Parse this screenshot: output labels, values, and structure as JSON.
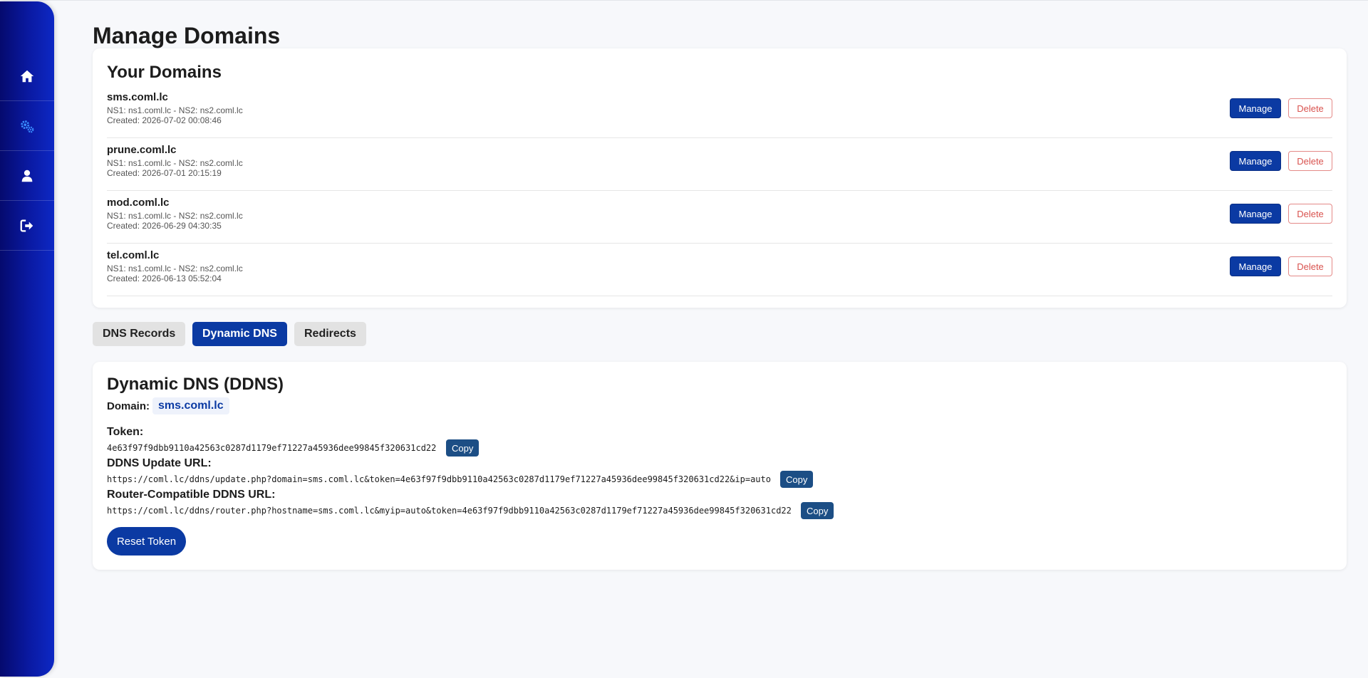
{
  "page": {
    "title": "Manage Domains"
  },
  "sidebar": {
    "items": [
      {
        "icon": "home-icon"
      },
      {
        "icon": "cogs-icon",
        "active": true
      },
      {
        "icon": "user-icon"
      },
      {
        "icon": "sign-out-icon"
      }
    ]
  },
  "domains_card": {
    "title": "Your Domains",
    "manage_label": "Manage",
    "delete_label": "Delete",
    "domains": [
      {
        "name": "sms.coml.lc",
        "ns": "NS1: ns1.coml.lc - NS2: ns2.coml.lc",
        "created": "Created: 2026-07-02 00:08:46"
      },
      {
        "name": "prune.coml.lc",
        "ns": "NS1: ns1.coml.lc - NS2: ns2.coml.lc",
        "created": "Created: 2026-07-01 20:15:19"
      },
      {
        "name": "mod.coml.lc",
        "ns": "NS1: ns1.coml.lc - NS2: ns2.coml.lc",
        "created": "Created: 2026-06-29 04:30:35"
      },
      {
        "name": "tel.coml.lc",
        "ns": "NS1: ns1.coml.lc - NS2: ns2.coml.lc",
        "created": "Created: 2026-06-13 05:52:04"
      }
    ]
  },
  "tabs": [
    {
      "label": "DNS Records",
      "active": false
    },
    {
      "label": "Dynamic DNS",
      "active": true
    },
    {
      "label": "Redirects",
      "active": false
    }
  ],
  "ddns": {
    "title": "Dynamic DNS (DDNS)",
    "domain_label": "Domain:",
    "domain_value": "sms.coml.lc",
    "token_label": "Token:",
    "token_value": "4e63f97f9dbb9110a42563c0287d1179ef71227a45936dee99845f320631cd22",
    "update_url_label": "DDNS Update URL:",
    "update_url_value": "https://coml.lc/ddns/update.php?domain=sms.coml.lc&token=4e63f97f9dbb9110a42563c0287d1179ef71227a45936dee99845f320631cd22&ip=auto",
    "router_url_label": "Router-Compatible DDNS URL:",
    "router_url_value": "https://coml.lc/ddns/router.php?hostname=sms.coml.lc&myip=auto&token=4e63f97f9dbb9110a42563c0287d1179ef71227a45936dee99845f320631cd22",
    "copy_label": "Copy",
    "reset_label": "Reset Token"
  },
  "colors": {
    "primary": "#0b3aa3",
    "danger": "#d9534f",
    "copy_button": "#1c4e85",
    "sidebar_dark": "#050a6e",
    "sidebar_light": "#0d28c4",
    "active_icon": "#3a8dff"
  }
}
